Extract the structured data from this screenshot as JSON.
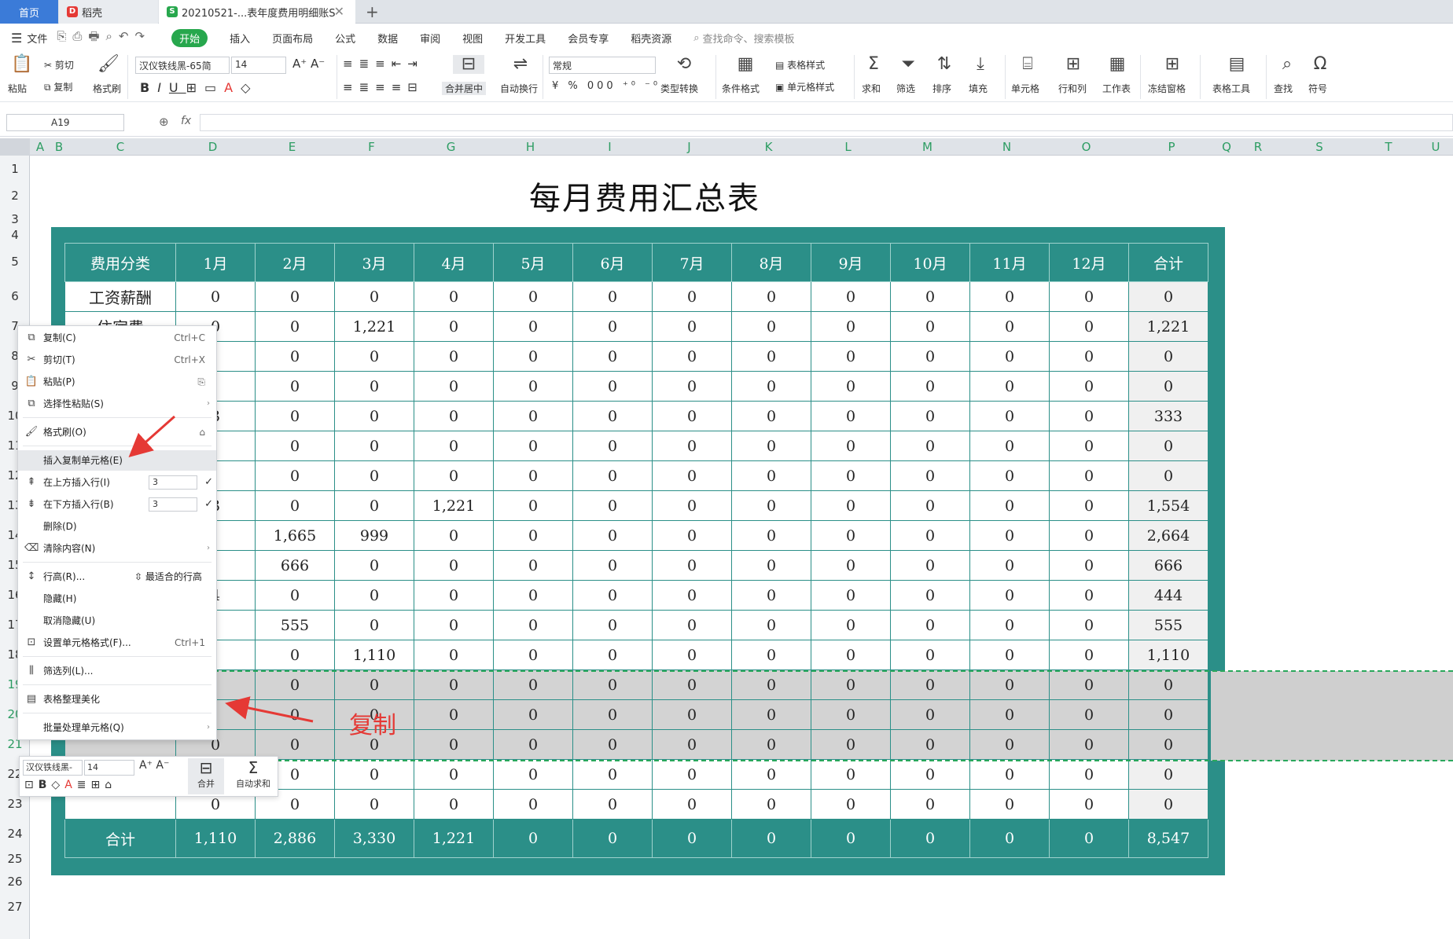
{
  "tabs": {
    "home": "首页",
    "daoke": "稻壳",
    "document": "20210521-...表年度费用明细账S",
    "add": "+"
  },
  "menubar": {
    "file": "文件",
    "items": [
      "开始",
      "插入",
      "页面布局",
      "公式",
      "数据",
      "审阅",
      "视图",
      "开发工具",
      "会员专享",
      "稻壳资源"
    ],
    "search_placeholder": "查找命令、搜索模板"
  },
  "ribbon": {
    "paste": "粘贴",
    "cut": "剪切",
    "copy": "复制",
    "format_painter": "格式刷",
    "font_name": "汉仪铁线黑-65简",
    "font_size": "14",
    "merge_center": "合并居中",
    "auto_wrap": "自动换行",
    "number_format": "常规",
    "type_convert": "类型转换",
    "conditional_format": "条件格式",
    "table_style": "表格样式",
    "cell_style": "单元格样式",
    "sum": "求和",
    "filter": "筛选",
    "sort": "排序",
    "fill": "填充",
    "cell": "单元格",
    "row_col": "行和列",
    "worksheet": "工作表",
    "freeze": "冻结窗格",
    "table_tools": "表格工具",
    "find": "查找",
    "symbol": "符号"
  },
  "formula_bar": {
    "name_box": "A19",
    "fx": "fx",
    "formula": ""
  },
  "column_headers": [
    "A",
    "B",
    "C",
    "D",
    "E",
    "F",
    "G",
    "H",
    "I",
    "J",
    "K",
    "L",
    "M",
    "N",
    "O",
    "P",
    "Q",
    "R",
    "S",
    "T",
    "U"
  ],
  "row_headers": [
    "1",
    "2",
    "3",
    "4",
    "5",
    "6",
    "7",
    "8",
    "9",
    "10",
    "11",
    "12",
    "13",
    "14",
    "15",
    "16",
    "17",
    "18",
    "19",
    "20",
    "21",
    "22",
    "23",
    "24",
    "25",
    "26",
    "27"
  ],
  "sheet": {
    "title": "每月费用汇总表",
    "headers": [
      "费用分类",
      "1月",
      "2月",
      "3月",
      "4月",
      "5月",
      "6月",
      "7月",
      "8月",
      "9月",
      "10月",
      "11月",
      "12月",
      "合计"
    ],
    "rows": [
      [
        "工资薪酬",
        "0",
        "0",
        "0",
        "0",
        "0",
        "0",
        "0",
        "0",
        "0",
        "0",
        "0",
        "0",
        "0"
      ],
      [
        "住宿费",
        "0",
        "0",
        "1,221",
        "0",
        "0",
        "0",
        "0",
        "0",
        "0",
        "0",
        "0",
        "0",
        "1,221"
      ],
      [
        "",
        "",
        "0",
        "0",
        "0",
        "0",
        "0",
        "0",
        "0",
        "0",
        "0",
        "0",
        "0",
        "0"
      ],
      [
        "",
        "",
        "0",
        "0",
        "0",
        "0",
        "0",
        "0",
        "0",
        "0",
        "0",
        "0",
        "0",
        "0"
      ],
      [
        "",
        "3",
        "0",
        "0",
        "0",
        "0",
        "0",
        "0",
        "0",
        "0",
        "0",
        "0",
        "0",
        "333"
      ],
      [
        "",
        "",
        "0",
        "0",
        "0",
        "0",
        "0",
        "0",
        "0",
        "0",
        "0",
        "0",
        "0",
        "0"
      ],
      [
        "",
        "",
        "0",
        "0",
        "0",
        "0",
        "0",
        "0",
        "0",
        "0",
        "0",
        "0",
        "0",
        "0"
      ],
      [
        "",
        "3",
        "0",
        "0",
        "1,221",
        "0",
        "0",
        "0",
        "0",
        "0",
        "0",
        "0",
        "0",
        "1,554"
      ],
      [
        "",
        "",
        "1,665",
        "999",
        "0",
        "0",
        "0",
        "0",
        "0",
        "0",
        "0",
        "0",
        "0",
        "2,664"
      ],
      [
        "",
        "",
        "666",
        "0",
        "0",
        "0",
        "0",
        "0",
        "0",
        "0",
        "0",
        "0",
        "0",
        "666"
      ],
      [
        "",
        "4",
        "0",
        "0",
        "0",
        "0",
        "0",
        "0",
        "0",
        "0",
        "0",
        "0",
        "0",
        "444"
      ],
      [
        "",
        "",
        "555",
        "0",
        "0",
        "0",
        "0",
        "0",
        "0",
        "0",
        "0",
        "0",
        "0",
        "555"
      ],
      [
        "",
        "",
        "0",
        "1,110",
        "0",
        "0",
        "0",
        "0",
        "0",
        "0",
        "0",
        "0",
        "0",
        "1,110"
      ],
      [
        "",
        "",
        "0",
        "0",
        "0",
        "0",
        "0",
        "0",
        "0",
        "0",
        "0",
        "0",
        "0",
        "0"
      ],
      [
        "",
        "",
        "0",
        "0",
        "0",
        "0",
        "0",
        "0",
        "0",
        "0",
        "0",
        "0",
        "0",
        "0"
      ],
      [
        "",
        "0",
        "0",
        "0",
        "0",
        "0",
        "0",
        "0",
        "0",
        "0",
        "0",
        "0",
        "0",
        "0"
      ],
      [
        "",
        "",
        "0",
        "0",
        "0",
        "0",
        "0",
        "0",
        "0",
        "0",
        "0",
        "0",
        "0",
        "0"
      ],
      [
        "",
        "0",
        "0",
        "0",
        "0",
        "0",
        "0",
        "0",
        "0",
        "0",
        "0",
        "0",
        "0",
        "0"
      ]
    ],
    "selected_row_indices": [
      13,
      14,
      15
    ],
    "footer": [
      "合计",
      "1,110",
      "2,886",
      "3,330",
      "1,221",
      "0",
      "0",
      "0",
      "0",
      "0",
      "0",
      "0",
      "0",
      "8,547"
    ]
  },
  "context_menu": {
    "copy": "复制(C)",
    "copy_sc": "Ctrl+C",
    "cut": "剪切(T)",
    "cut_sc": "Ctrl+X",
    "paste": "粘贴(P)",
    "paste_special": "选择性粘贴(S)",
    "format_painter": "格式刷(O)",
    "insert_copied": "插入复制单元格(E)",
    "insert_above": "在上方插入行(I)",
    "insert_above_count": "3",
    "insert_below": "在下方插入行(B)",
    "insert_below_count": "3",
    "delete": "删除(D)",
    "clear": "清除内容(N)",
    "row_height": "行高(R)...",
    "best_fit": "最适合的行高",
    "hide": "隐藏(H)",
    "unhide": "取消隐藏(U)",
    "format_cells": "设置单元格格式(F)...",
    "format_cells_sc": "Ctrl+1",
    "filter_col": "筛选列(L)...",
    "beautify": "表格整理美化",
    "batch": "批量处理单元格(Q)"
  },
  "mini_toolbar": {
    "font_name": "汉仪铁线黑-",
    "font_size": "14",
    "merge": "合并",
    "autosum": "自动求和"
  },
  "annotation": {
    "text": "复制",
    "color": "#e53935"
  },
  "colors": {
    "teal": "#2b8f88",
    "accent_green": "#27a74d",
    "tab_blue": "#3b7bd8"
  }
}
